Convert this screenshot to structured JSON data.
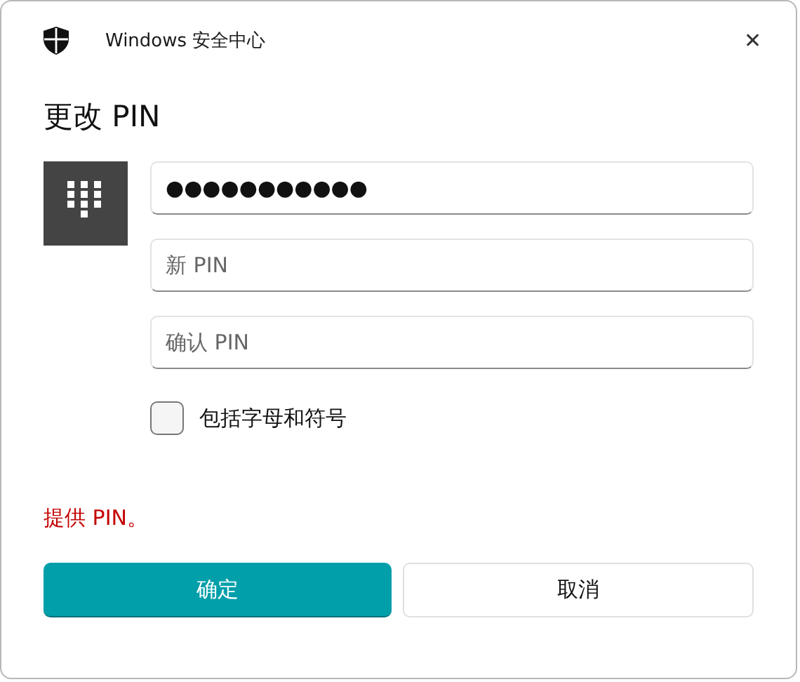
{
  "window": {
    "title": "Windows 安全中心",
    "close": "✕"
  },
  "heading": "更改 PIN",
  "fields": [
    {
      "value": "●●●●●●●●●●●"
    },
    {
      "placeholder": "新 PIN"
    },
    {
      "placeholder": "确认 PIN"
    }
  ],
  "checkbox": {
    "label": "包括字母和符号",
    "checked": false
  },
  "error": "提供 PIN。",
  "buttons": [
    {
      "label": "确定",
      "kind": "primary"
    },
    {
      "label": "取消",
      "kind": "secondary"
    }
  ]
}
